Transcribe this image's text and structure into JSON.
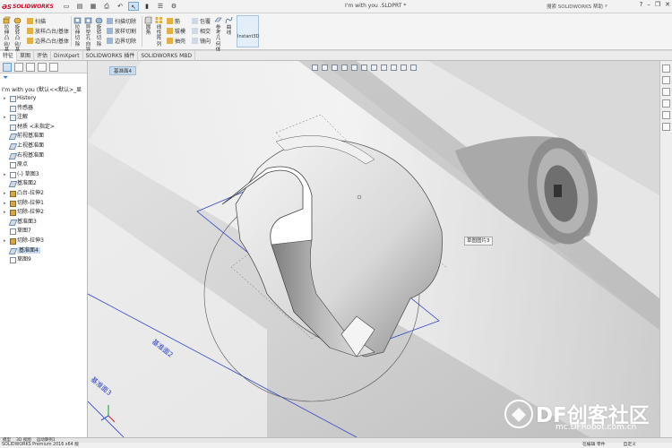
{
  "app": {
    "brand": "SOLIDWORKS",
    "document_title": "I'm with you .SLDPRT *",
    "help_search_placeholder": "搜索 SOLIDWORKS 帮助"
  },
  "ribbon": {
    "big_buttons": [
      {
        "label": "拉伸凸台/基体",
        "icon": "extrude-boss-icon"
      },
      {
        "label": "旋转凸台/基体",
        "icon": "revolve-boss-icon"
      },
      {
        "label": "扫描",
        "icon": "sweep-icon"
      },
      {
        "label": "拉伸切除",
        "icon": "extrude-cut-icon"
      },
      {
        "label": "异型孔向导",
        "icon": "hole-wizard-icon"
      },
      {
        "label": "旋转切除",
        "icon": "revolved-cut-icon"
      },
      {
        "label": "圆角",
        "icon": "fillet-icon"
      },
      {
        "label": "线性阵列",
        "icon": "linear-pattern-icon"
      },
      {
        "label": "参考几何体",
        "icon": "reference-geometry-icon"
      },
      {
        "label": "曲线",
        "icon": "curves-icon"
      }
    ],
    "small_buttons": [
      {
        "label": "扫描",
        "icon": "sweep-icon"
      },
      {
        "label": "放样凸台/基体",
        "icon": "loft-icon"
      },
      {
        "label": "边界凸台/基体",
        "icon": "boundary-boss-icon"
      },
      {
        "label": "扫描切除",
        "icon": "swept-cut-icon"
      },
      {
        "label": "放样切割",
        "icon": "lofted-cut-icon"
      },
      {
        "label": "边界切除",
        "icon": "boundary-cut-icon"
      },
      {
        "label": "筋",
        "icon": "rib-icon"
      },
      {
        "label": "拔模",
        "icon": "draft-icon"
      },
      {
        "label": "抽壳",
        "icon": "shell-icon"
      },
      {
        "label": "包覆",
        "icon": "wrap-icon"
      },
      {
        "label": "相交",
        "icon": "intersect-icon"
      },
      {
        "label": "镜向",
        "icon": "mirror-icon"
      }
    ],
    "instant3d_label": "Instant3D"
  },
  "command_tabs": [
    "特征",
    "草图",
    "评估",
    "DimXpert",
    "SOLIDWORKS 插件",
    "SOLIDWORKS MBD"
  ],
  "feature_tree": {
    "root": "I'm with you  (默认<<默认>_显",
    "items": [
      {
        "label": "History",
        "expand": "▸",
        "kind": "folder"
      },
      {
        "label": "传感器",
        "expand": "",
        "kind": "folder"
      },
      {
        "label": "注解",
        "expand": "▸",
        "kind": "folder"
      },
      {
        "label": "材质 <未指定>",
        "expand": "",
        "kind": "folder"
      },
      {
        "label": "前视基准面",
        "expand": "",
        "kind": "plane"
      },
      {
        "label": "上视基准面",
        "expand": "",
        "kind": "plane"
      },
      {
        "label": "右视基准面",
        "expand": "",
        "kind": "plane"
      },
      {
        "label": "原点",
        "expand": "",
        "kind": "sk"
      },
      {
        "label": "(-) 草图3",
        "expand": "▸",
        "kind": "sk"
      },
      {
        "label": "基准面2",
        "expand": "",
        "kind": "plane"
      },
      {
        "label": "凸台-拉伸2",
        "expand": "▸",
        "kind": "feat"
      },
      {
        "label": "切除-拉伸1",
        "expand": "▸",
        "kind": "feat"
      },
      {
        "label": "切除-拉伸2",
        "expand": "▸",
        "kind": "feat"
      },
      {
        "label": "基准面3",
        "expand": "",
        "kind": "plane"
      },
      {
        "label": "草图7",
        "expand": "",
        "kind": "sk"
      },
      {
        "label": "切除-拉伸3",
        "expand": "▸",
        "kind": "feat"
      },
      {
        "label": "基准面4",
        "expand": "",
        "kind": "plane",
        "highlight": true
      },
      {
        "label": "草图9",
        "expand": "",
        "kind": "sk"
      }
    ]
  },
  "viewport": {
    "selected_label": "基准面4",
    "sketch_picture_label": "草图图片3",
    "plane_labels": [
      "基准面2",
      "基准面3"
    ]
  },
  "bottom_tabs": [
    "模型",
    "3D 视图",
    "运动算例1"
  ],
  "status": {
    "left": "SOLIDWORKS Premium 2016 x64 版",
    "editing": "在编辑 零件",
    "units": "自定义"
  },
  "watermark": {
    "text": "DF创客社区",
    "url": "mc.DFRobot.com.cn"
  },
  "colors": {
    "accent_blue": "#2a3fc8",
    "brand_red": "#c8102e",
    "tree_highlight": "#c7dcf1"
  }
}
